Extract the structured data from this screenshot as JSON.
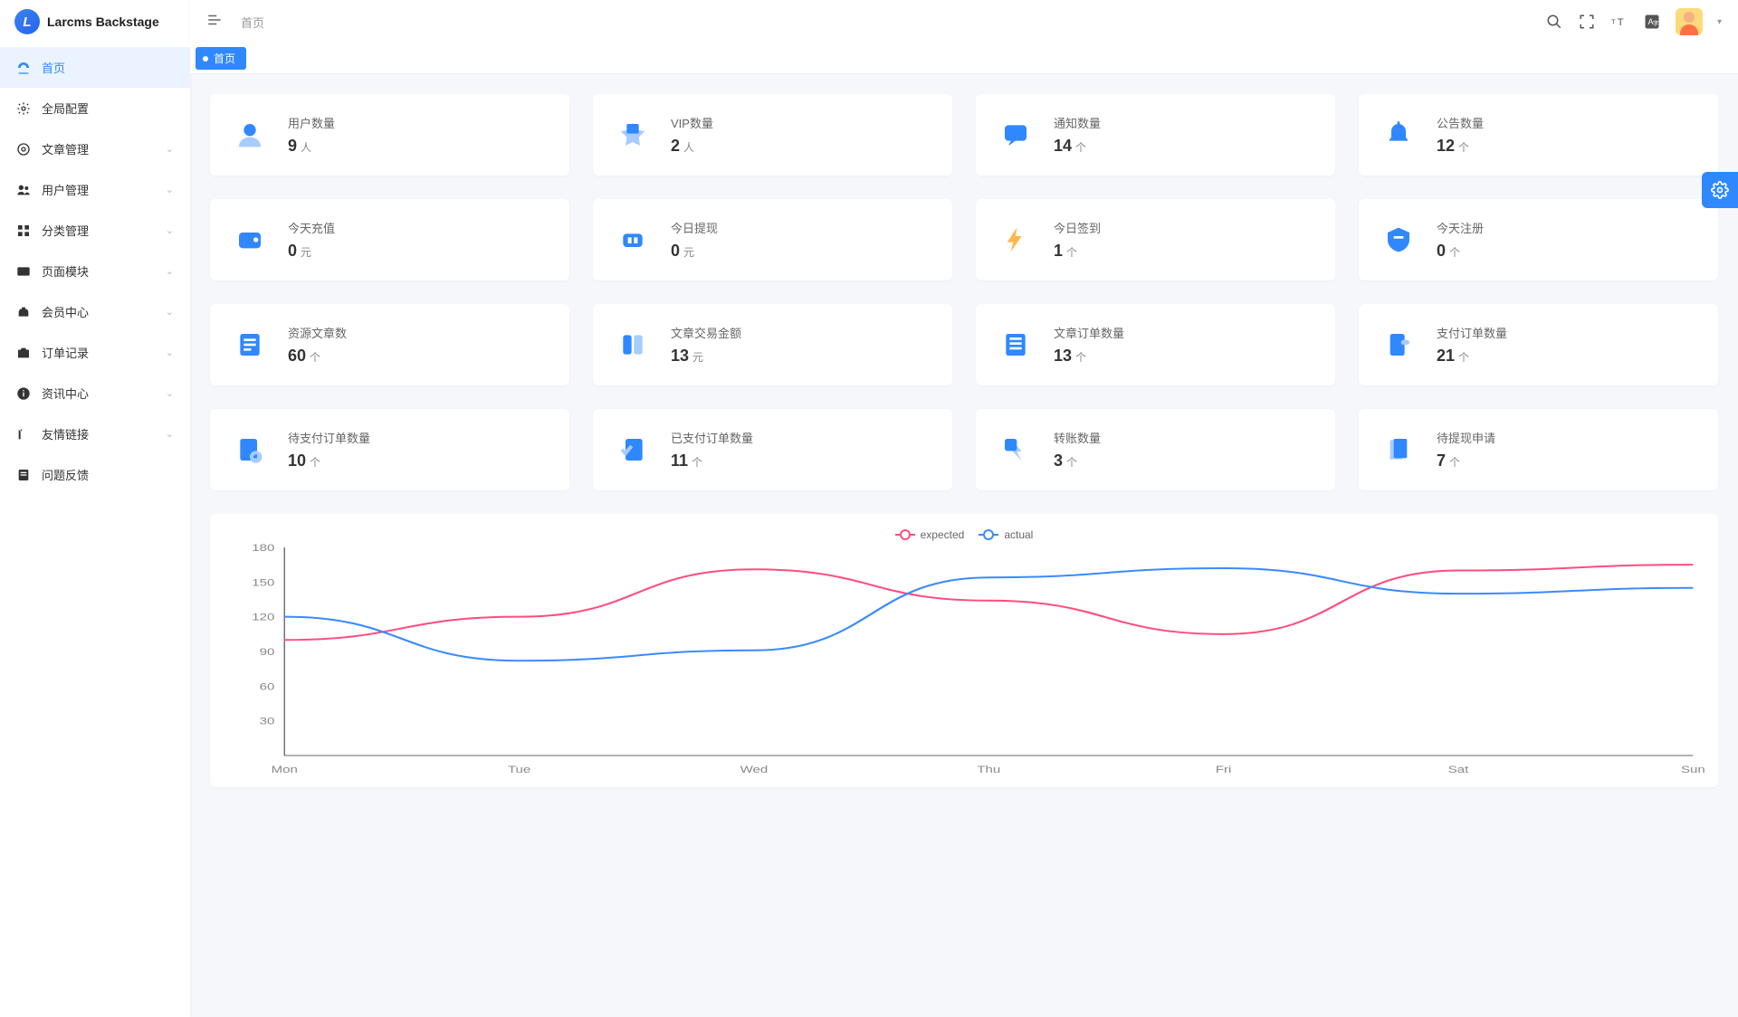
{
  "app_name": "Larcms Backstage",
  "breadcrumb": "首页",
  "active_tab": "首页",
  "sidebar": {
    "items": [
      {
        "label": "首页",
        "icon": "dashboard",
        "active": true,
        "expandable": false
      },
      {
        "label": "全局配置",
        "icon": "gear",
        "active": false,
        "expandable": false
      },
      {
        "label": "文章管理",
        "icon": "article",
        "active": false,
        "expandable": true
      },
      {
        "label": "用户管理",
        "icon": "users",
        "active": false,
        "expandable": true
      },
      {
        "label": "分类管理",
        "icon": "category",
        "active": false,
        "expandable": true
      },
      {
        "label": "页面模块",
        "icon": "page",
        "active": false,
        "expandable": true
      },
      {
        "label": "会员中心",
        "icon": "member",
        "active": false,
        "expandable": true
      },
      {
        "label": "订单记录",
        "icon": "order",
        "active": false,
        "expandable": true
      },
      {
        "label": "资讯中心",
        "icon": "info",
        "active": false,
        "expandable": true
      },
      {
        "label": "友情链接",
        "icon": "link",
        "active": false,
        "expandable": true
      },
      {
        "label": "问题反馈",
        "icon": "feedback",
        "active": false,
        "expandable": false
      }
    ]
  },
  "cards": [
    {
      "title": "用户数量",
      "value": "9",
      "unit": "人",
      "icon": "user"
    },
    {
      "title": "VIP数量",
      "value": "2",
      "unit": "人",
      "icon": "vip"
    },
    {
      "title": "通知数量",
      "value": "14",
      "unit": "个",
      "icon": "notice"
    },
    {
      "title": "公告数量",
      "value": "12",
      "unit": "个",
      "icon": "bell"
    },
    {
      "title": "今天充值",
      "value": "0",
      "unit": "元",
      "icon": "wallet"
    },
    {
      "title": "今日提现",
      "value": "0",
      "unit": "元",
      "icon": "withdraw"
    },
    {
      "title": "今日签到",
      "value": "1",
      "unit": "个",
      "icon": "bolt"
    },
    {
      "title": "今天注册",
      "value": "0",
      "unit": "个",
      "icon": "shield"
    },
    {
      "title": "资源文章数",
      "value": "60",
      "unit": "个",
      "icon": "doc-lines"
    },
    {
      "title": "文章交易金额",
      "value": "13",
      "unit": "元",
      "icon": "columns"
    },
    {
      "title": "文章订单数量",
      "value": "13",
      "unit": "个",
      "icon": "sheet"
    },
    {
      "title": "支付订单数量",
      "value": "21",
      "unit": "个",
      "icon": "receipt"
    },
    {
      "title": "待支付订单数量",
      "value": "10",
      "unit": "个",
      "icon": "pending"
    },
    {
      "title": "已支付订单数量",
      "value": "11",
      "unit": "个",
      "icon": "paid"
    },
    {
      "title": "转账数量",
      "value": "3",
      "unit": "个",
      "icon": "transfer"
    },
    {
      "title": "待提现申请",
      "value": "7",
      "unit": "个",
      "icon": "apply"
    }
  ],
  "chart_data": {
    "type": "line",
    "categories": [
      "Mon",
      "Tue",
      "Wed",
      "Thu",
      "Fri",
      "Sat",
      "Sun"
    ],
    "series": [
      {
        "name": "expected",
        "color": "#ff4d7e",
        "values": [
          100,
          120,
          161,
          134,
          105,
          160,
          165
        ]
      },
      {
        "name": "actual",
        "color": "#3a8bff",
        "values": [
          120,
          82,
          91,
          154,
          162,
          140,
          145
        ]
      }
    ],
    "ylabel": "",
    "xlabel": "",
    "ylim": [
      0,
      180
    ],
    "yticks": [
      30,
      60,
      90,
      120,
      150,
      180
    ]
  },
  "colors": {
    "primary": "#2f88ff",
    "background": "#f5f7fa"
  }
}
